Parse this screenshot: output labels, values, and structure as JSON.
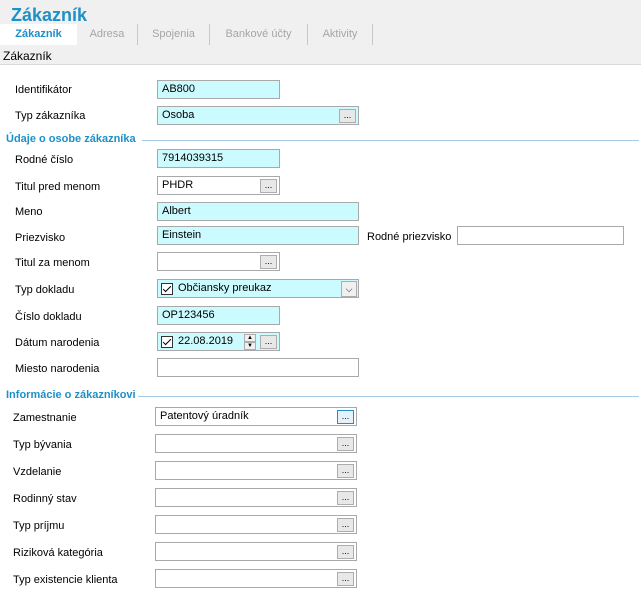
{
  "window": {
    "title": "Zákazník"
  },
  "tabs": [
    {
      "label": "Zákazník",
      "active": true
    },
    {
      "label": "Adresa"
    },
    {
      "label": "Spojenia"
    },
    {
      "label": "Bankové účty"
    },
    {
      "label": "Aktivity"
    }
  ],
  "subheader": "Zákazník",
  "customer": {
    "identifier_label": "Identifikátor",
    "identifier_value": "AB800",
    "type_label": "Typ zákazníka",
    "type_value": "Osoba"
  },
  "person": {
    "section_title": "Údaje o osobe zákazníka",
    "birth_number_label": "Rodné číslo",
    "birth_number_value": "7914039315",
    "title_before_label": "Titul pred menom",
    "title_before_value": "PHDR",
    "first_name_label": "Meno",
    "first_name_value": "Albert",
    "surname_label": "Priezvisko",
    "surname_value": "Einstein",
    "birth_surname_label": "Rodné priezvisko",
    "birth_surname_value": "",
    "title_after_label": "Titul za menom",
    "title_after_value": "",
    "doc_type_label": "Typ dokladu",
    "doc_type_value": "Občiansky preukaz",
    "doc_number_label": "Číslo dokladu",
    "doc_number_value": "OP123456",
    "birth_date_label": "Dátum narodenia",
    "birth_date_value": "22.08.2019",
    "birth_place_label": "Miesto narodenia",
    "birth_place_value": ""
  },
  "info": {
    "section_title": "Informácie o zákazníkovi",
    "fields": [
      {
        "label": "Zamestnanie",
        "value": "Patentový úradník"
      },
      {
        "label": "Typ bývania",
        "value": ""
      },
      {
        "label": "Vzdelanie",
        "value": ""
      },
      {
        "label": "Rodinný stav",
        "value": ""
      },
      {
        "label": "Typ príjmu",
        "value": ""
      },
      {
        "label": "Riziková kategória",
        "value": ""
      },
      {
        "label": "Typ existencie klienta",
        "value": ""
      }
    ]
  },
  "ui": {
    "ellipsis": "...",
    "dropdown_arrow": "⌵",
    "spin_up": "▲",
    "spin_down": "▼"
  },
  "colors": {
    "accent": "#1e90c8",
    "required_field": "#ccfbff",
    "section_line": "#a7c9e6"
  },
  "icons": {
    "dropdown": "chevron-down-icon",
    "checkbox": "check-icon"
  }
}
